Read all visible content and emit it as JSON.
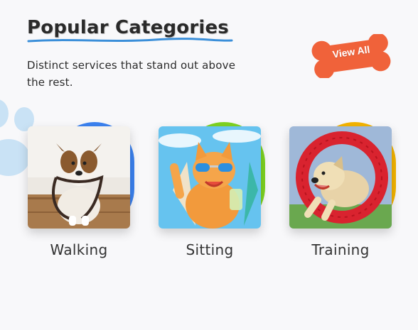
{
  "header": {
    "title": "Popular Categories",
    "subtitle": "Distinct services that stand out above the rest.",
    "view_all_label": "View All"
  },
  "colors": {
    "accent_orange": "#f0623a",
    "underline_blue": "#3b8fd9",
    "paw_blue": "#c9e2f5"
  },
  "categories": [
    {
      "label": "Walking",
      "image": "dog-with-leash-photo",
      "blob_color": "#3b82f0"
    },
    {
      "label": "Sitting",
      "image": "cat-in-sunglasses-photo",
      "blob_color": "#7ed321"
    },
    {
      "label": "Training",
      "image": "dog-jumping-through-hoop-photo",
      "blob_color": "#f4b400"
    }
  ]
}
